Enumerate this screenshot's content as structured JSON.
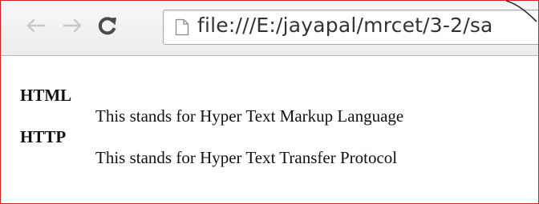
{
  "browser": {
    "back_label": "←",
    "forward_label": "→",
    "reload_icon": "reload-icon",
    "address": "file:///E:/jayapal/mrcet/3-2/sa",
    "colors": {
      "frame_border": "#d42020",
      "toolbar_bg": "#ececec",
      "arrow_disabled": "#c8c8c8",
      "reload": "#4a4a4a"
    }
  },
  "definitions": [
    {
      "term": "HTML",
      "description": "This stands for Hyper Text Markup Language"
    },
    {
      "term": "HTTP",
      "description": "This stands for Hyper Text Transfer Protocol"
    }
  ]
}
